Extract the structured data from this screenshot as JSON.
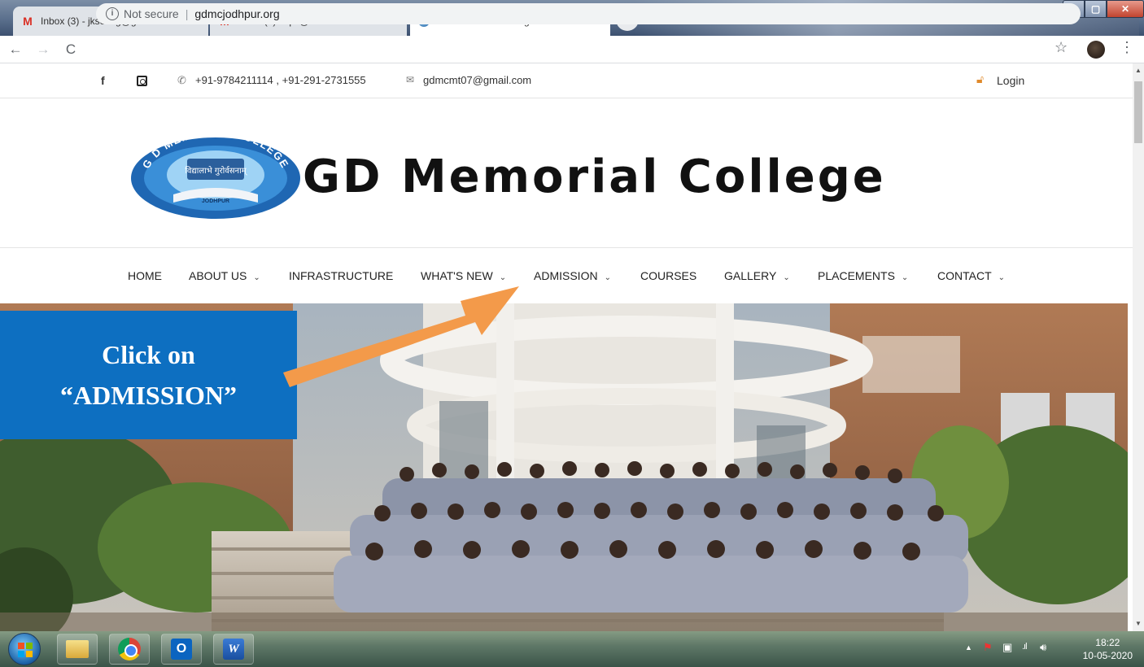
{
  "browser": {
    "tabs": [
      {
        "title": "Inbox (3) - jksevag@gmail.com -",
        "icon": "gmail-icon"
      },
      {
        "title": "Inbox (1) - lips@btu.ac.in - Bikan",
        "icon": "gmail-icon"
      },
      {
        "title": "G.D. Memorial College",
        "icon": "globe-icon"
      }
    ],
    "gmail_glyph": "M",
    "close_glyph": "×",
    "new_tab_glyph": "+",
    "security": "Not secure",
    "url": "gdmcjodhpur.org"
  },
  "topbar": {
    "facebook_glyph": "f",
    "phone": "+91-9784211114 , +91-291-2731555",
    "email": "gdmcmt07@gmail.com",
    "login": "Login"
  },
  "header": {
    "college_name": "GD Memorial College",
    "logo_arc_text": "G D MEMORIAL COLLEGE",
    "logo_motto": "विद्यालाभे गुरोर्वसनाम्",
    "logo_city": "JODHPUR"
  },
  "nav": {
    "items": [
      {
        "label": "HOME",
        "dropdown": false
      },
      {
        "label": "ABOUT US",
        "dropdown": true
      },
      {
        "label": "INFRASTRUCTURE",
        "dropdown": false
      },
      {
        "label": "WHAT'S NEW",
        "dropdown": true
      },
      {
        "label": "ADMISSION",
        "dropdown": true
      },
      {
        "label": "COURSES",
        "dropdown": false
      },
      {
        "label": "GALLERY",
        "dropdown": true
      },
      {
        "label": "PLACEMENTS",
        "dropdown": true
      },
      {
        "label": "CONTACT",
        "dropdown": true
      }
    ],
    "chevron_glyph": "⌄"
  },
  "annotation": {
    "line1": "Click on",
    "line2": "“ADMISSION”",
    "box_color": "#0d6fc1",
    "arrow_color": "#f39a4a"
  },
  "taskbar": {
    "time": "18:22",
    "date": "10-05-2020",
    "outlook_glyph": "O",
    "word_glyph": "W"
  }
}
